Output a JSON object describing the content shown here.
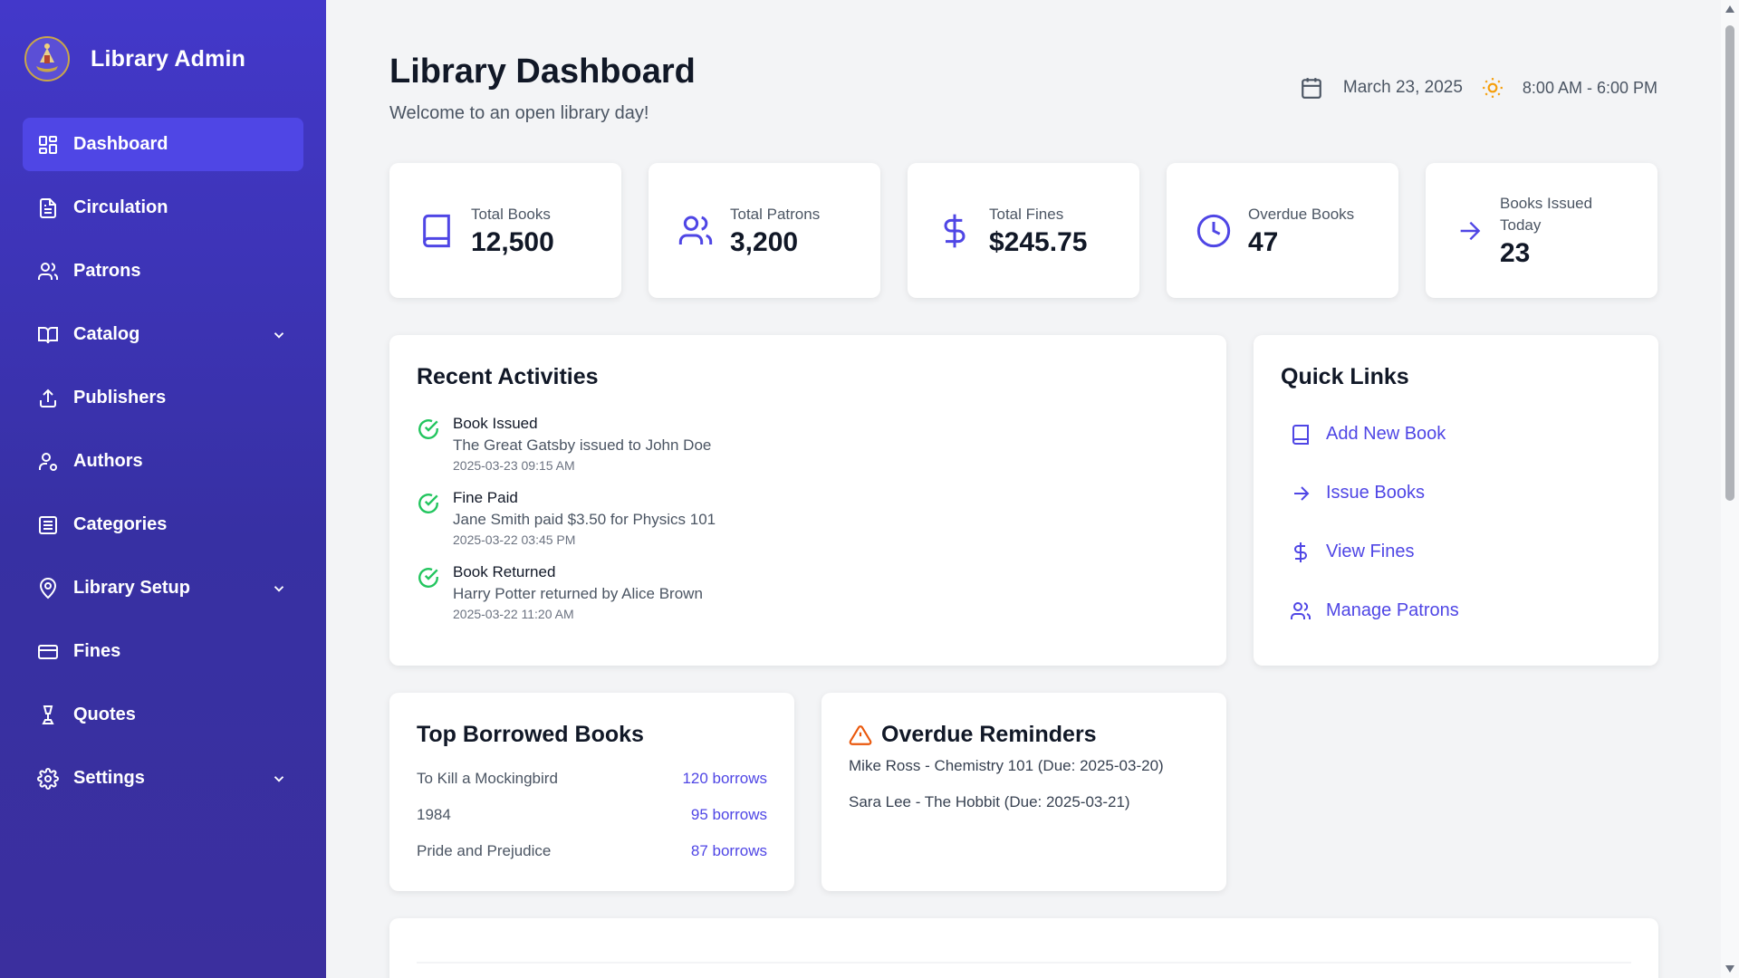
{
  "brand": {
    "title": "Library Admin",
    "logo_icon": "library-crest-icon"
  },
  "sidebar": {
    "items": [
      {
        "label": "Dashboard",
        "icon": "dashboard-icon",
        "active": true,
        "has_chevron": false
      },
      {
        "label": "Circulation",
        "icon": "document-icon",
        "active": false,
        "has_chevron": false
      },
      {
        "label": "Patrons",
        "icon": "users-icon",
        "active": false,
        "has_chevron": false
      },
      {
        "label": "Catalog",
        "icon": "open-book-icon",
        "active": false,
        "has_chevron": true
      },
      {
        "label": "Publishers",
        "icon": "upload-icon",
        "active": false,
        "has_chevron": false
      },
      {
        "label": "Authors",
        "icon": "user-cog-icon",
        "active": false,
        "has_chevron": false
      },
      {
        "label": "Categories",
        "icon": "list-icon",
        "active": false,
        "has_chevron": false
      },
      {
        "label": "Library Setup",
        "icon": "map-pin-icon",
        "active": false,
        "has_chevron": true
      },
      {
        "label": "Fines",
        "icon": "credit-card-icon",
        "active": false,
        "has_chevron": false
      },
      {
        "label": "Quotes",
        "icon": "lamp-icon",
        "active": false,
        "has_chevron": false
      },
      {
        "label": "Settings",
        "icon": "gear-icon",
        "active": false,
        "has_chevron": true
      }
    ]
  },
  "header": {
    "title": "Library Dashboard",
    "subtitle": "Welcome to an open library day!",
    "date": "March 23, 2025",
    "hours": "8:00 AM - 6:00 PM"
  },
  "stats": [
    {
      "label": "Total Books",
      "value": "12,500",
      "icon": "book-icon"
    },
    {
      "label": "Total Patrons",
      "value": "3,200",
      "icon": "users-icon"
    },
    {
      "label": "Total Fines",
      "value": "$245.75",
      "icon": "dollar-icon"
    },
    {
      "label": "Overdue Books",
      "value": "47",
      "icon": "clock-icon"
    },
    {
      "label": "Books Issued Today",
      "value": "23",
      "icon": "arrow-right-icon"
    }
  ],
  "recent": {
    "title": "Recent Activities",
    "items": [
      {
        "title": "Book Issued",
        "desc": "The Great Gatsby issued to John Doe",
        "time": "2025-03-23 09:15 AM"
      },
      {
        "title": "Fine Paid",
        "desc": "Jane Smith paid $3.50 for Physics 101",
        "time": "2025-03-22 03:45 PM"
      },
      {
        "title": "Book Returned",
        "desc": "Harry Potter returned by Alice Brown",
        "time": "2025-03-22 11:20 AM"
      }
    ]
  },
  "quick_links": {
    "title": "Quick Links",
    "items": [
      {
        "label": "Add New Book",
        "icon": "book-icon"
      },
      {
        "label": "Issue Books",
        "icon": "arrow-right-icon"
      },
      {
        "label": "View Fines",
        "icon": "dollar-icon"
      },
      {
        "label": "Manage Patrons",
        "icon": "users-icon"
      }
    ]
  },
  "top_books": {
    "title": "Top Borrowed Books",
    "items": [
      {
        "title": "To Kill a Mockingbird",
        "count": "120 borrows"
      },
      {
        "title": "1984",
        "count": "95 borrows"
      },
      {
        "title": "Pride and Prejudice",
        "count": "87 borrows"
      }
    ]
  },
  "overdue": {
    "title": "Overdue Reminders",
    "items": [
      {
        "text": "Mike Ross - Chemistry 101 (Due: 2025-03-20)"
      },
      {
        "text": "Sara Lee - The Hobbit (Due: 2025-03-21)"
      }
    ]
  },
  "colors": {
    "sidebar": "#4338ca",
    "accent": "#4f46e5",
    "success": "#22c55e",
    "warning": "#ea580c",
    "sun": "#f59e0b"
  }
}
